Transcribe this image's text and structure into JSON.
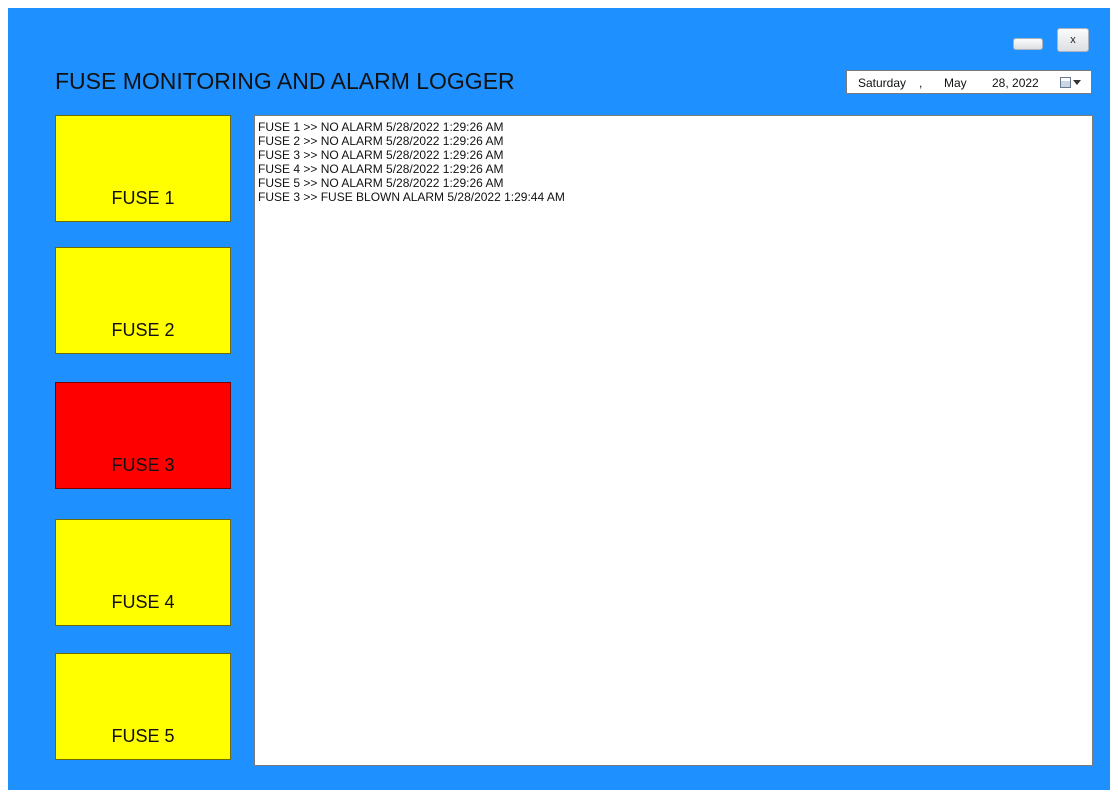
{
  "window": {
    "title": "FUSE MONITORING AND ALARM LOGGER",
    "close_label": "x",
    "background_color": "#1e90ff"
  },
  "date_picker": {
    "day_of_week": "Saturday",
    "separator": ",",
    "month": "May",
    "date_year": "28, 2022",
    "icon": "calendar-dropdown-icon"
  },
  "fuses": [
    {
      "label": "FUSE 1",
      "status": "ok",
      "color": "#ffff00"
    },
    {
      "label": "FUSE 2",
      "status": "ok",
      "color": "#ffff00"
    },
    {
      "label": "FUSE 3",
      "status": "alarm",
      "color": "#ff0000"
    },
    {
      "label": "FUSE 4",
      "status": "ok",
      "color": "#ffff00"
    },
    {
      "label": "FUSE 5",
      "status": "ok",
      "color": "#ffff00"
    }
  ],
  "log": [
    "FUSE 1 >> NO ALARM 5/28/2022 1:29:26 AM",
    "FUSE 2 >> NO ALARM 5/28/2022 1:29:26 AM",
    "FUSE 3 >> NO ALARM 5/28/2022 1:29:26 AM",
    "FUSE 4 >> NO ALARM 5/28/2022 1:29:26 AM",
    "FUSE 5 >> NO ALARM 5/28/2022 1:29:26 AM",
    "FUSE 3 >> FUSE BLOWN ALARM 5/28/2022 1:29:44 AM"
  ]
}
